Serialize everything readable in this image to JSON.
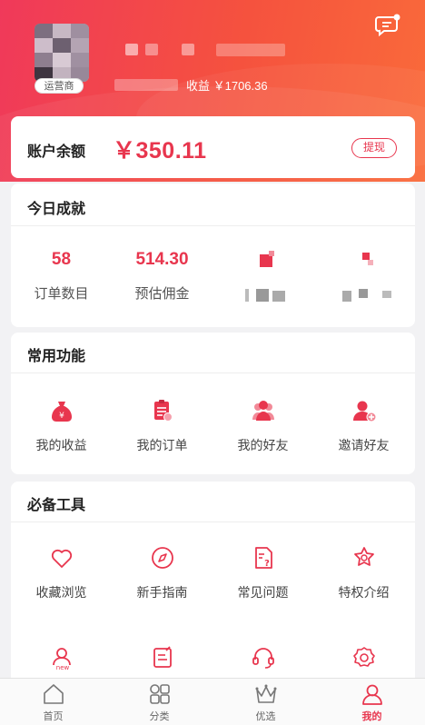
{
  "colors": {
    "primary": "#e8364e",
    "header_start": "#f0395a",
    "header_end": "#fa6b3a"
  },
  "header": {
    "role_badge": "运营商",
    "earnings_text": "收益 ￥1706.36",
    "message_icon": "message-bubble-icon"
  },
  "balance": {
    "label": "账户余额",
    "amount": "￥350.11",
    "withdraw_label": "提现"
  },
  "today": {
    "title": "今日成就",
    "stats": [
      {
        "value": "58",
        "label": "订单数目"
      },
      {
        "value": "514.30",
        "label": "预估佣金"
      }
    ]
  },
  "common": {
    "title": "常用功能",
    "items": [
      {
        "label": "我的收益",
        "icon": "money-bag-icon"
      },
      {
        "label": "我的订单",
        "icon": "order-list-icon"
      },
      {
        "label": "我的好友",
        "icon": "friends-icon"
      },
      {
        "label": "邀请好友",
        "icon": "invite-user-icon"
      }
    ]
  },
  "tools": {
    "title": "必备工具",
    "items": [
      {
        "label": "收藏浏览",
        "icon": "heart-icon"
      },
      {
        "label": "新手指南",
        "icon": "compass-icon"
      },
      {
        "label": "常见问题",
        "icon": "question-doc-icon"
      },
      {
        "label": "特权介绍",
        "icon": "star-badge-icon"
      }
    ],
    "second_row_icons": [
      "new-user-icon",
      "edit-note-icon",
      "headset-icon",
      "settings-icon"
    ]
  },
  "tabbar": {
    "items": [
      {
        "label": "首页",
        "icon": "home-icon"
      },
      {
        "label": "分类",
        "icon": "category-grid-icon"
      },
      {
        "label": "优选",
        "icon": "crown-icon"
      },
      {
        "label": "我的",
        "icon": "user-icon"
      }
    ],
    "active_index": 3
  }
}
